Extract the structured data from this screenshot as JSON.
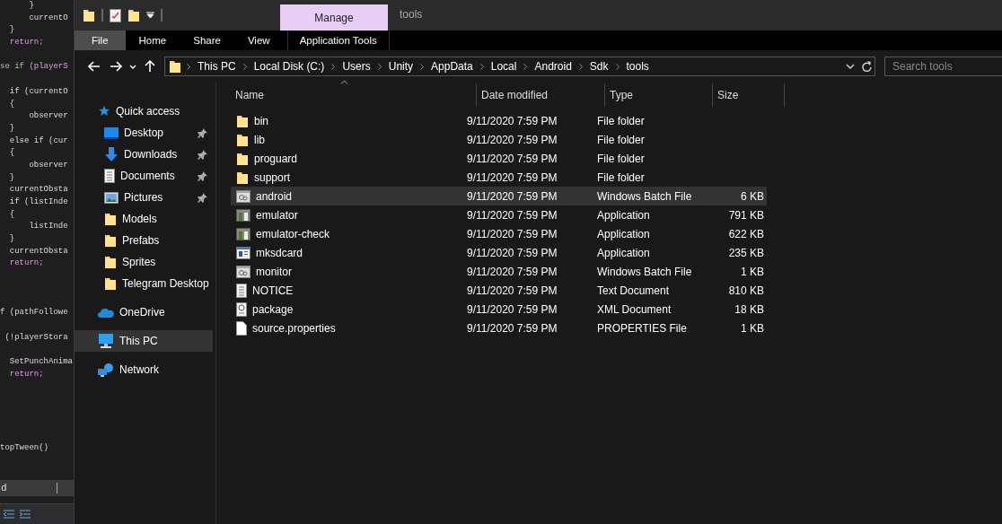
{
  "editor": {
    "lines": [
      {
        "kind": "code",
        "text": "      }"
      },
      {
        "kind": "code",
        "text": "      currentO"
      },
      {
        "kind": "code",
        "text": "  }"
      },
      {
        "kind": "keyword",
        "text": "  return;"
      },
      {
        "kind": "blank"
      },
      {
        "kind": "keyword",
        "text": "se if (playerS"
      },
      {
        "kind": "blank"
      },
      {
        "kind": "code",
        "text": "  if (currentO"
      },
      {
        "kind": "code",
        "text": "  {"
      },
      {
        "kind": "code",
        "text": "      observer"
      },
      {
        "kind": "code",
        "text": "  }"
      },
      {
        "kind": "code",
        "text": "  else if (cur"
      },
      {
        "kind": "code",
        "text": "  {"
      },
      {
        "kind": "code",
        "text": "      observer"
      },
      {
        "kind": "code",
        "text": "  }"
      },
      {
        "kind": "code",
        "text": "  currentObsta"
      },
      {
        "kind": "code",
        "text": "  if (listInde"
      },
      {
        "kind": "code",
        "text": "  {"
      },
      {
        "kind": "code",
        "text": "      listInde"
      },
      {
        "kind": "code",
        "text": "  }"
      },
      {
        "kind": "code",
        "text": "  currentObsta"
      },
      {
        "kind": "keyword",
        "text": "  return;"
      },
      {
        "kind": "blank"
      },
      {
        "kind": "blank"
      },
      {
        "kind": "blank"
      },
      {
        "kind": "code",
        "text": "f (pathFollowe"
      },
      {
        "kind": "blank"
      },
      {
        "kind": "code",
        "text": " (!playerStora"
      },
      {
        "kind": "blank"
      },
      {
        "kind": "code",
        "text": "  SetPunchAnima"
      },
      {
        "kind": "keyword",
        "text": "  return;"
      },
      {
        "kind": "blank"
      },
      {
        "kind": "blank"
      },
      {
        "kind": "blank"
      },
      {
        "kind": "blank"
      },
      {
        "kind": "blank"
      },
      {
        "kind": "code",
        "text": "topTween()"
      }
    ],
    "bottom_bar": {
      "text": "d"
    }
  },
  "explorer": {
    "title": "tools",
    "context_tab": "Manage",
    "ribbon_tabs": [
      {
        "label": "File",
        "selected": true
      },
      {
        "label": "Home",
        "selected": false
      },
      {
        "label": "Share",
        "selected": false
      },
      {
        "label": "View",
        "selected": false
      },
      {
        "label": "Application Tools",
        "selected": false
      }
    ],
    "address": {
      "crumbs": [
        "This PC",
        "Local Disk (C:)",
        "Users",
        "Unity",
        "AppData",
        "Local",
        "Android",
        "Sdk",
        "tools"
      ]
    },
    "search": {
      "placeholder": "Search tools"
    },
    "sidebar": {
      "items": [
        {
          "label": "Quick access",
          "kind": "star",
          "selected": false,
          "children": [
            {
              "label": "Desktop",
              "kind": "desktop",
              "pinned": true,
              "selected": false
            },
            {
              "label": "Downloads",
              "kind": "download",
              "pinned": true,
              "selected": false
            },
            {
              "label": "Documents",
              "kind": "document",
              "pinned": true,
              "selected": false
            },
            {
              "label": "Pictures",
              "kind": "pictures",
              "pinned": true,
              "selected": false
            },
            {
              "label": "Models",
              "kind": "folder",
              "pinned": false,
              "selected": false
            },
            {
              "label": "Prefabs",
              "kind": "folder",
              "pinned": false,
              "selected": false
            },
            {
              "label": "Sprites",
              "kind": "folder",
              "pinned": false,
              "selected": false
            },
            {
              "label": "Telegram Desktop",
              "kind": "folder",
              "pinned": false,
              "selected": false
            }
          ]
        },
        {
          "label": "OneDrive",
          "kind": "cloud",
          "selected": false
        },
        {
          "label": "This PC",
          "kind": "computer",
          "selected": true
        },
        {
          "label": "Network",
          "kind": "network",
          "selected": false
        }
      ]
    },
    "columns": [
      "Name",
      "Date modified",
      "Type",
      "Size"
    ],
    "rows": [
      {
        "kind": "folder",
        "name": "bin",
        "date": "9/11/2020 7:59 PM",
        "type": "File folder",
        "selected": false
      },
      {
        "kind": "folder",
        "name": "lib",
        "date": "9/11/2020 7:59 PM",
        "type": "File folder",
        "selected": false
      },
      {
        "kind": "folder",
        "name": "proguard",
        "date": "9/11/2020 7:59 PM",
        "type": "File folder",
        "selected": false
      },
      {
        "kind": "folder",
        "name": "support",
        "date": "9/11/2020 7:59 PM",
        "type": "File folder",
        "selected": false
      },
      {
        "kind": "batch",
        "name": "android",
        "date": "9/11/2020 7:59 PM",
        "type": "Windows Batch File",
        "size": "6 KB",
        "selected": true
      },
      {
        "kind": "app",
        "name": "emulator",
        "date": "9/11/2020 7:59 PM",
        "type": "Application",
        "size": "791 KB",
        "selected": false
      },
      {
        "kind": "app",
        "name": "emulator-check",
        "date": "9/11/2020 7:59 PM",
        "type": "Application",
        "size": "622 KB",
        "selected": false
      },
      {
        "kind": "window-app",
        "name": "mksdcard",
        "date": "9/11/2020 7:59 PM",
        "type": "Application",
        "size": "235 KB",
        "selected": false
      },
      {
        "kind": "batch",
        "name": "monitor",
        "date": "9/11/2020 7:59 PM",
        "type": "Windows Batch File",
        "size": "1 KB",
        "selected": false
      },
      {
        "kind": "text",
        "name": "NOTICE",
        "date": "9/11/2020 7:59 PM",
        "type": "Text Document",
        "size": "810 KB",
        "selected": false
      },
      {
        "kind": "xml",
        "name": "package",
        "date": "9/11/2020 7:59 PM",
        "type": "XML Document",
        "size": "18 KB",
        "selected": false
      },
      {
        "kind": "file",
        "name": "source.properties",
        "date": "9/11/2020 7:59 PM",
        "type": "PROPERTIES File",
        "size": "1 KB",
        "selected": false
      }
    ]
  }
}
